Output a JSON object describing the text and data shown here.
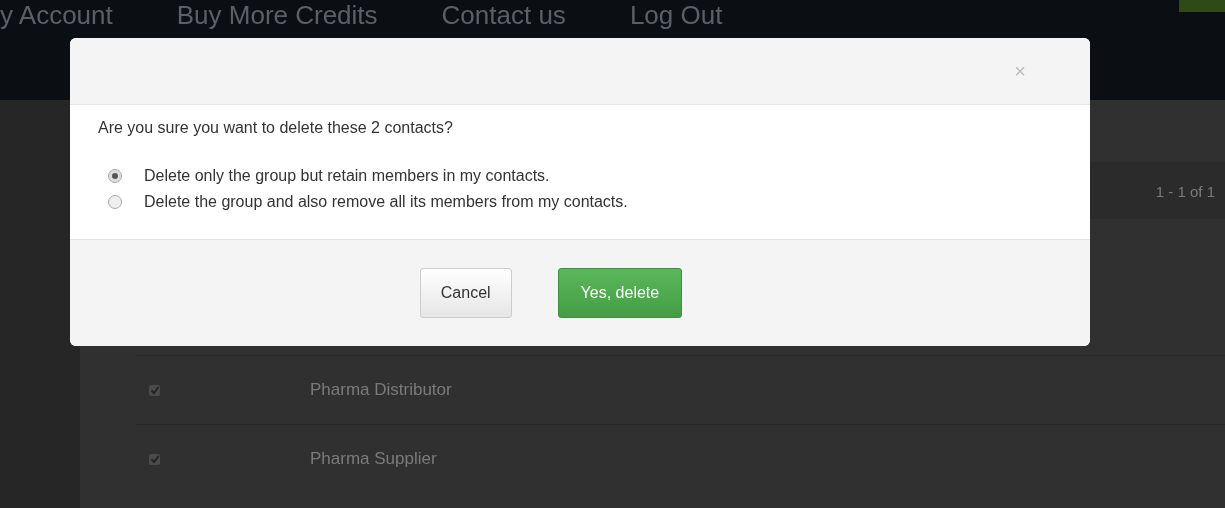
{
  "nav": {
    "links": [
      "y Account",
      "Buy More Credits",
      "Contact us",
      "Log Out"
    ]
  },
  "pagination": "1 - 1 of 1",
  "rows": [
    {
      "name": "Pharma Distributor",
      "checked": true
    },
    {
      "name": "Pharma Supplier",
      "checked": true
    }
  ],
  "dialog": {
    "close": "×",
    "message": "Are you sure you want to delete these 2 contacts?",
    "options": [
      {
        "label": "Delete only the group but retain members in my contacts.",
        "selected": true
      },
      {
        "label": "Delete the group and also remove all its members from my contacts.",
        "selected": false
      }
    ],
    "buttons": [
      {
        "label": "Cancel",
        "kind": "default"
      },
      {
        "label": "Yes, delete",
        "kind": "primary"
      }
    ]
  }
}
